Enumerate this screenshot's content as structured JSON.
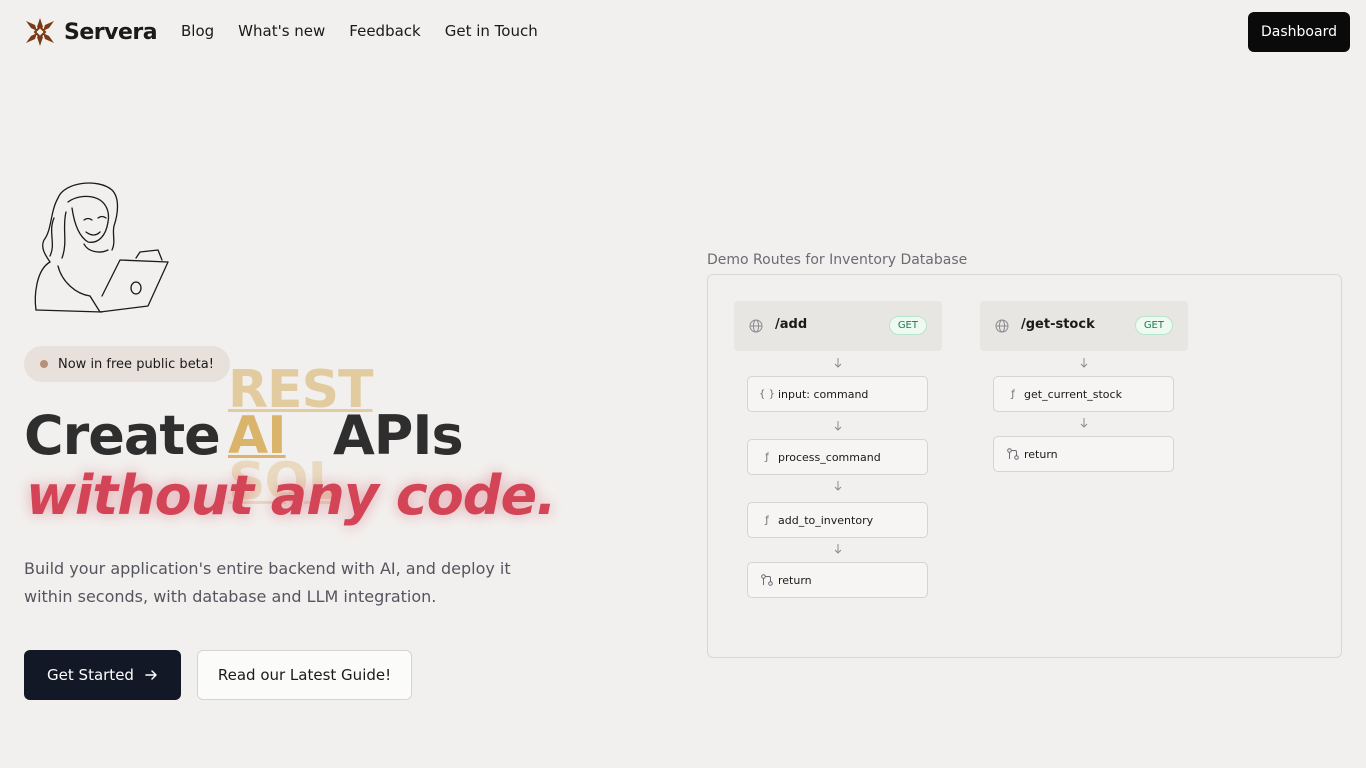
{
  "brand": {
    "name": "Servera",
    "color": "#7a3a14"
  },
  "nav": {
    "items": [
      "Blog",
      "What's new",
      "Feedback",
      "Get in Touch"
    ]
  },
  "header": {
    "dashboard_label": "Dashboard"
  },
  "hero": {
    "beta_label": "Now in free public beta!",
    "title_create": "Create",
    "rotating_words": [
      "REST",
      "AI",
      "SQL"
    ],
    "title_apis": "APIs",
    "title_line2": "without any code.",
    "subtitle": "Build your application's entire backend with AI, and deploy it within seconds, with database and LLM integration.",
    "primary_button": "Get Started",
    "secondary_button": "Read our Latest Guide!",
    "accent_color": "#d24456",
    "rotator_color": "#d9b46a"
  },
  "demo": {
    "label": "Demo Routes for Inventory Database",
    "routes": [
      {
        "path": "/add",
        "method": "GET",
        "steps": [
          {
            "icon": "braces-icon",
            "text": "input: command"
          },
          {
            "icon": "function-icon",
            "text": "process_command"
          },
          {
            "icon": "function-icon",
            "text": "add_to_inventory"
          },
          {
            "icon": "return-icon",
            "text": "return"
          }
        ]
      },
      {
        "path": "/get-stock",
        "method": "GET",
        "steps": [
          {
            "icon": "function-icon",
            "text": "get_current_stock"
          },
          {
            "icon": "return-icon",
            "text": "return"
          }
        ]
      }
    ]
  }
}
